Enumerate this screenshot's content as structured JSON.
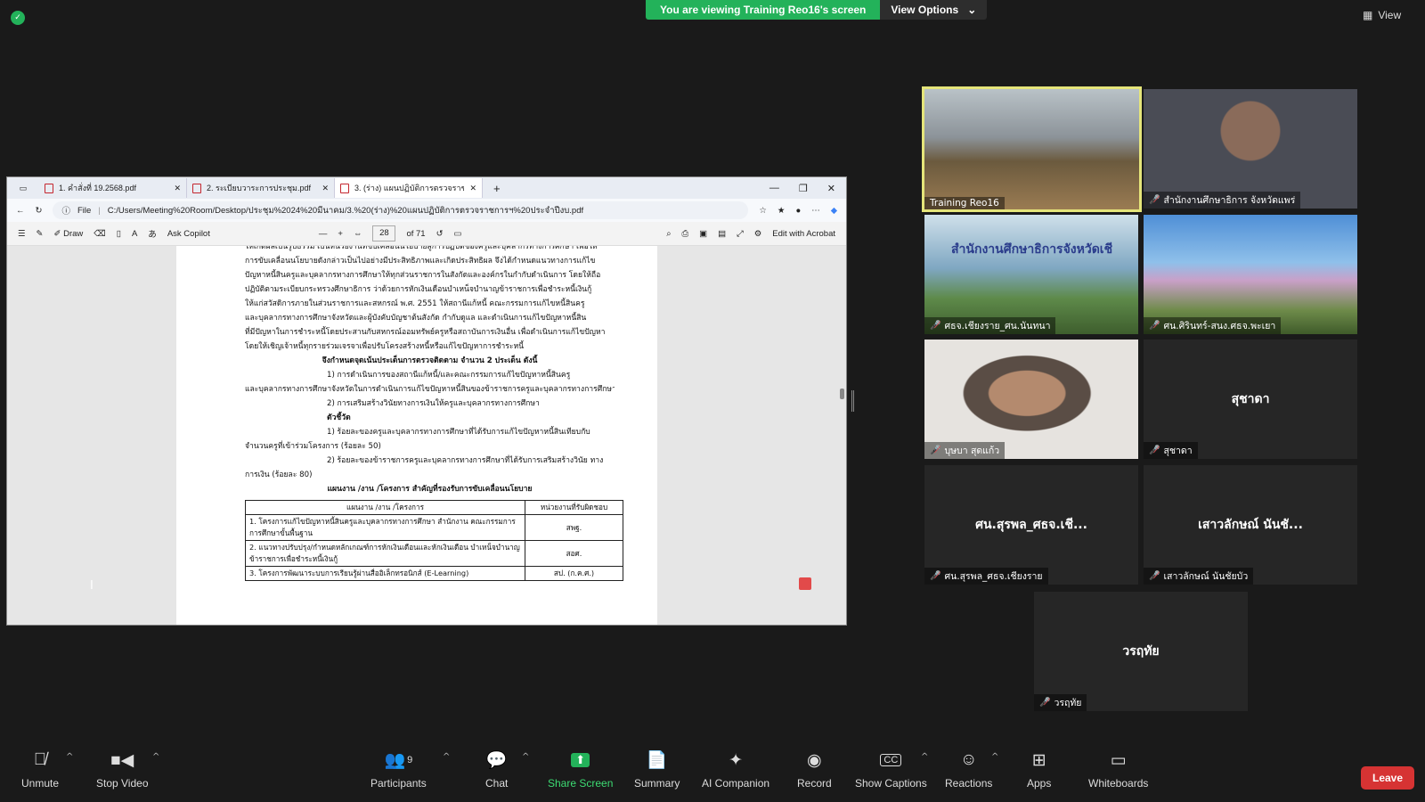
{
  "banner": {
    "viewing": "You are viewing Training Reo16's screen",
    "view_options": "View Options"
  },
  "view_button": "View",
  "pdf": {
    "tabs": [
      "1. คำสั่งที่ 19.2568.pdf",
      "2. ระเบียบวาระการประชุม.pdf",
      "3. (ร่าง) แผนปฏิบัติการตรวจราชการ ..."
    ],
    "address_prefix": "File",
    "address": "C:/Users/Meeting%20Room/Desktop/ประชุม%2024%20มีนาคม/3.%20(ร่าง)%20แผนปฏิบัติการตรวจราชการฯ%20ประจำปีงบ.pdf",
    "toolbar": {
      "draw": "Draw",
      "ask_copilot": "Ask Copilot",
      "page": "28",
      "of": "of 71",
      "edit": "Edit with Acrobat"
    },
    "lines": [
      "ให้เกิดผลเป็นรูปธรรม เป็นหน่วยงานที่ขับเคลื่อนนโยบายสู่การปฏิบัติของครูและบุคลากรทางการศึกษา เพื่อให้",
      "การขับเคลื่อนนโยบายดังกล่าวเป็นไปอย่างมีประสิทธิภาพและเกิดประสิทธิผล จึงได้กำหนดแนวทางการแก้ไข",
      "ปัญหาหนี้สินครูและบุคลากรทางการศึกษาให้ทุกส่วนราชการในสังกัดและองค์กรในกำกับดำเนินการ โดยให้ถือ",
      "ปฏิบัติตามระเบียบกระทรวงศึกษาธิการ ว่าด้วยการหักเงินเดือนบำเหน็จบำนาญข้าราชการเพื่อชำระหนี้เงินกู้",
      "ให้แก่สวัสดิการภายในส่วนราชการและสหกรณ์ พ.ศ. 2551 ให้สถานีแก้หนี้ คณะกรรมการแก้ไขหนี้สินครู",
      "และบุคลากรทางการศึกษาจังหวัดและผู้บังคับบัญชาต้นสังกัด กำกับดูแล และดำเนินการแก้ไขปัญหาหนี้สิน",
      "ที่มีปัญหาในการชำระหนี้โดยประสานกับสหกรณ์ออมทรัพย์ครูหรือสถาบันการเงินอื่น เพื่อดำเนินการแก้ไขปัญหา",
      "โดยให้เชิญเจ้าหนี้ทุกรายร่วมเจรจาเพื่อปรับโครงสร้างหนี้หรือแก้ไขปัญหาการชำระหนี้"
    ],
    "heading1": "จึงกำหนดจุดเน้นประเด็นการตรวจติดตาม จำนวน 2 ประเด็น ดังนี้",
    "points": [
      "1) การดำเนินการของสถานีแก้หนี้/และคณะกรรมการแก้ไขปัญหาหนี้สินครู",
      "และบุคลากรทางการศึกษาจังหวัดในการดำเนินการแก้ไขปัญหาหนี้สินของข้าราชการครูและบุคลากรทางการศึกษา",
      "2) การเสริมสร้างวินัยทางการเงินให้ครูและบุคลากรทางการศึกษา"
    ],
    "indicator_title": "ตัวชี้วัด",
    "indicators": [
      "1) ร้อยละของครูและบุคลากรทางการศึกษาที่ได้รับการแก้ไขปัญหาหนี้สินเทียบกับ",
      "จำนวนครูที่เข้าร่วมโครงการ (ร้อยละ 50)",
      "2) ร้อยละของข้าราชการครูและบุคลากรทางการศึกษาที่ได้รับการเสริมสร้างวินัย ทาง",
      "การเงิน (ร้อยละ 80)"
    ],
    "heading2": "แผนงาน /งาน /โครงการ สำคัญที่รองรับการขับเคลื่อนนโยบาย",
    "table": {
      "headers": [
        "แผนงาน /งาน /โครงการ",
        "หน่วยงานที่รับผิดชอบ"
      ],
      "rows": [
        [
          "1. โครงการแก้ไขปัญหาหนี้สินครูและบุคลากรทางการศึกษา สำนักงาน คณะกรรมการการศึกษาขั้นพื้นฐาน",
          "สพฐ."
        ],
        [
          "2. แนวทางปรับปรุง/กำหนดหลักเกณฑ์การหักเงินเดือนและหักเงินเดือน บำเหน็จบำนาญข้าราชการเพื่อชำระหนี้เงินกู้",
          "สอศ."
        ],
        [
          "3. โครงการพัฒนาระบบการเรียนรู้ผ่านสื่ออิเล็กทรอนิกส์ (E-Learning)",
          "สป. (ก.ค.ศ.)"
        ]
      ]
    }
  },
  "gallery": [
    {
      "name": "Training Reo16",
      "muted": false,
      "type": "video"
    },
    {
      "name": "สำนักงานศึกษาธิการ จังหวัดแพร่",
      "muted": true,
      "type": "video"
    },
    {
      "name": "ศธจ.เชียงราย_ศน.นันทนา",
      "muted": true,
      "type": "video",
      "overlay": "สำนักงานศึกษาธิการจังหวัดเชี"
    },
    {
      "name": "ศน.ศิรินทร์-สนง.ศธจ.พะเยา",
      "muted": true,
      "type": "video"
    },
    {
      "name": "บุษบา สุดแก้ว",
      "muted": true,
      "type": "video"
    },
    {
      "name": "สุชาดา",
      "muted": true,
      "type": "name",
      "center": "สุชาดา"
    },
    {
      "name": "ศน.สุรพล_ศธจ.เชียงราย",
      "muted": true,
      "type": "name",
      "center": "ศน.สุรพล_ศธจ.เชี..."
    },
    {
      "name": "เสาวลักษณ์ นันชัยบัว",
      "muted": true,
      "type": "name",
      "center": "เสาวลักษณ์ นันชั..."
    },
    {
      "name": "วรฤทัย",
      "muted": true,
      "type": "name",
      "center": "วรฤทัย"
    }
  ],
  "toolbar": {
    "unmute": "Unmute",
    "stop_video": "Stop Video",
    "participants": "Participants",
    "participants_count": "9",
    "chat": "Chat",
    "share": "Share Screen",
    "summary": "Summary",
    "ai": "AI Companion",
    "record": "Record",
    "captions": "Show Captions",
    "reactions": "Reactions",
    "apps": "Apps",
    "whiteboards": "Whiteboards",
    "leave": "Leave"
  },
  "colors": {
    "share_green": "#23b25a",
    "leave_red": "#d63333",
    "active_speaker": "#e5e57a",
    "muted": "#e5484d"
  }
}
